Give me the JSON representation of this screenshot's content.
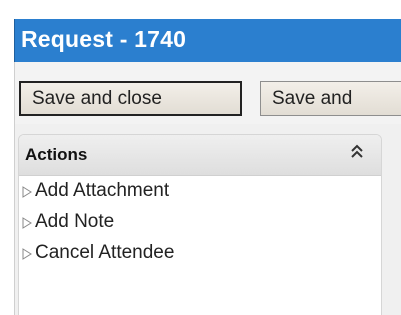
{
  "header": {
    "title": "Request - 1740"
  },
  "toolbar": {
    "save_close_label": "Save and close",
    "save_label": "Save and"
  },
  "actions": {
    "title": "Actions",
    "collapse_icon": "double-chevron-up-icon",
    "items": [
      {
        "label": "Add Attachment"
      },
      {
        "label": "Add Note"
      },
      {
        "label": "Cancel Attendee"
      }
    ]
  },
  "colors": {
    "header_bg": "#2b7fcf",
    "header_text": "#ffffff"
  }
}
